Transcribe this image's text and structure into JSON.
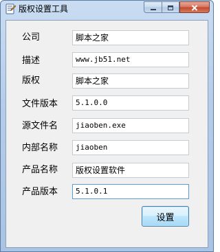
{
  "window": {
    "title": "版权设置工具"
  },
  "icons": {
    "app": "tool-icon",
    "minimize": "minimize-icon",
    "maximize": "maximize-icon",
    "close": "close-icon"
  },
  "form": {
    "fields": [
      {
        "label": "公司",
        "value": "脚本之家"
      },
      {
        "label": "描述",
        "value": "www.jb51.net"
      },
      {
        "label": "版权",
        "value": "脚本之家"
      },
      {
        "label": "文件版本",
        "value": "5.1.0.0"
      },
      {
        "label": "源文件名",
        "value": "jiaoben.exe"
      },
      {
        "label": "内部名称",
        "value": "jiaoben"
      },
      {
        "label": "产品名称",
        "value": "版权设置软件"
      },
      {
        "label": "产品版本",
        "value": "5.1.0.1"
      }
    ],
    "submit_label": "设置"
  },
  "colors": {
    "title_bar": "#b6cde9",
    "client_bg": "#f0f0f0",
    "close_button": "#c14a2d",
    "focus_border": "#5b9bd5"
  }
}
